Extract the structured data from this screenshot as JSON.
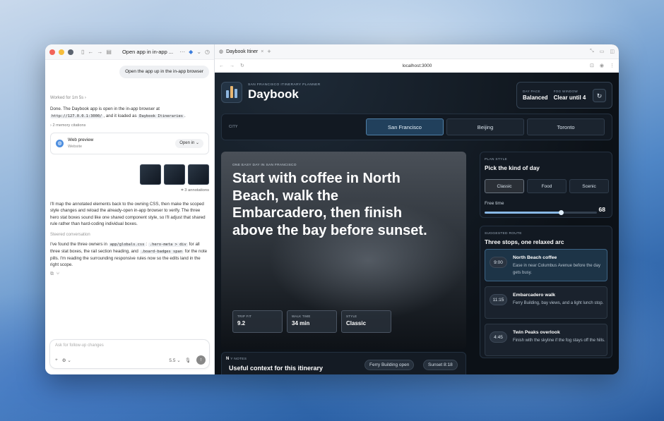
{
  "assistant": {
    "window_title": "Open app in in-app ...",
    "user_message": "Open the app up in the in-app browser",
    "worked_for": "Worked for 1m 5s",
    "reply_prefix": "Done. The Daybook app is open in the in-app browser at",
    "reply_url": "http://127.0.0.1:3000/",
    "reply_mid": ", and it loaded as",
    "reply_title": "Daybook Itineraries",
    "reply_end": ".",
    "citations": "2 memory citations",
    "preview_title": "Web preview",
    "preview_sub": "Website",
    "open_in": "Open in",
    "annotations": "3 annotations",
    "para1": "I'll map the annotated elements back to the owning CSS, then make the scoped style changes and reload the already-open in-app browser to verify. The three hero stat boxes sound like one shared component style, so I'll adjust that shared rule rather than hard-coding individual boxes.",
    "steered": "Steered conversation",
    "para2_a": "I've found the three owners in",
    "para2_code1": "app/globals.css",
    "para2_b": ":",
    "para2_code2": ".hero-meta > div",
    "para2_c": "for all three stat boxes, the rail section heading, and",
    "para2_code3": ".board-badges span",
    "para2_d": "for the note pills. I'm reading the surrounding responsive rules now so the edits land in the right scope.",
    "composer_placeholder": "Ask for follow-up changes",
    "model": "5.5"
  },
  "browser": {
    "tab_title": "Daybook Itiner",
    "url": "localhost:3000"
  },
  "app": {
    "kicker": "SAN FRANCISCO ITINERARY PLANNER",
    "brand": "Daybook",
    "day_pace_label": "DAY PACE",
    "day_pace": "Balanced",
    "fog_label": "FOG WINDOW",
    "fog": "Clear until 4",
    "city_label": "CITY",
    "cities": [
      "San Francisco",
      "Beijing",
      "Toronto"
    ],
    "hero_kicker": "ONE EASY DAY IN SAN FRANCISCO",
    "hero_title": "Start with coffee in North Beach, walk the Embarcadero, then finish above the bay before sunset.",
    "stats": [
      {
        "label": "TRIP FIT",
        "value": "9.2"
      },
      {
        "label": "WALK TIME",
        "value": "34 min"
      },
      {
        "label": "STYLE",
        "value": "Classic"
      }
    ],
    "notes_label": "Y NOTES",
    "notes_initial": "N",
    "notes_title": "Useful context for this itinerary",
    "note_pills": [
      "Ferry Building open",
      "Sunset 8:18"
    ],
    "plan_label": "PLAN STYLE",
    "plan_title": "Pick the kind of day",
    "styles": [
      "Classic",
      "Food",
      "Scenic"
    ],
    "free_time_label": "Free time",
    "free_time": "68",
    "free_time_fraction": 0.68,
    "route_label": "SUGGESTED ROUTE",
    "route_title": "Three stops, one relaxed arc",
    "stops": [
      {
        "time": "9:00",
        "name": "North Beach coffee",
        "desc": "Ease in near Columbus Avenue before the day gets busy."
      },
      {
        "time": "11:15",
        "name": "Embarcadero walk",
        "desc": "Ferry Building, bay views, and a light lunch stop."
      },
      {
        "time": "4:45",
        "name": "Twin Peaks overlook",
        "desc": "Finish with the skyline if the fog stays off the hills."
      }
    ]
  }
}
